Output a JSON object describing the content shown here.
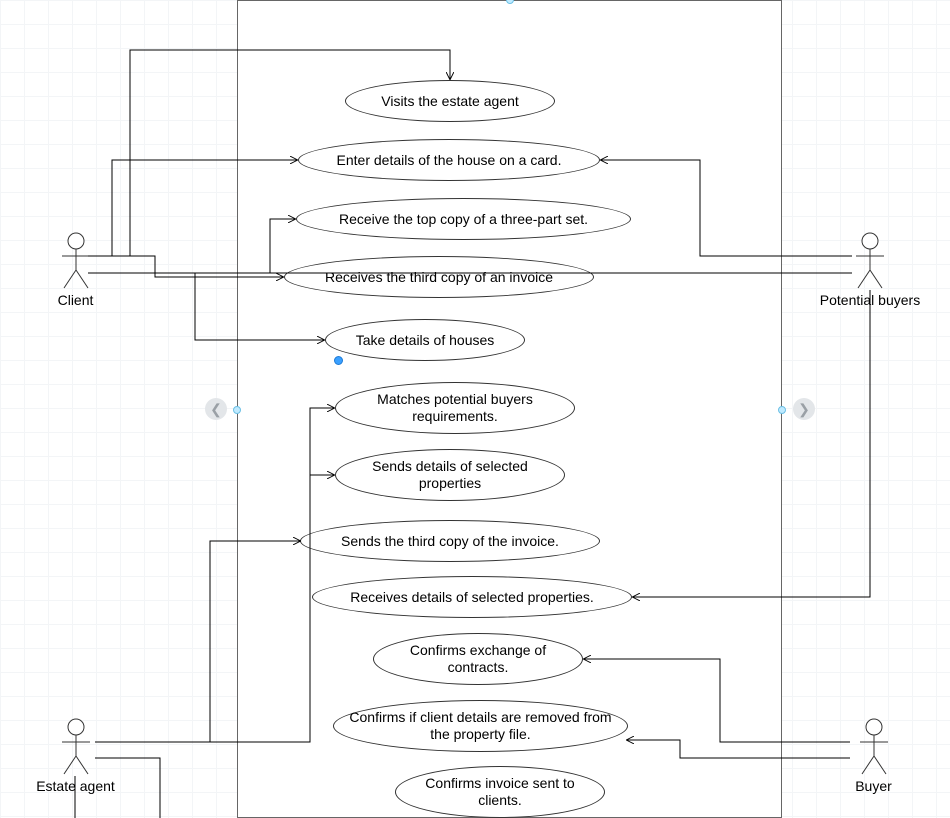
{
  "actors": {
    "client": {
      "label": "Client"
    },
    "potential_buyers": {
      "label": "Potential buyers"
    },
    "estate_agent": {
      "label": "Estate agent"
    },
    "buyer": {
      "label": "Buyer"
    }
  },
  "usecases": {
    "uc1": {
      "label": "Visits the estate agent"
    },
    "uc2": {
      "label": "Enter details of the house on a card."
    },
    "uc3": {
      "label": "Receive the top copy of a three-part set."
    },
    "uc4": {
      "label": "Receives the third copy of an invoice"
    },
    "uc5": {
      "label": "Take details of houses"
    },
    "uc6": {
      "label": "Matches potential buyers requirements."
    },
    "uc7": {
      "label": "Sends details of selected properties"
    },
    "uc8": {
      "label": "Sends the third copy of the invoice."
    },
    "uc9": {
      "label": "Receives details of selected properties."
    },
    "uc10": {
      "label": "Confirms exchange of contracts."
    },
    "uc11": {
      "label": "Confirms if client details are removed from the property file."
    },
    "uc12": {
      "label": "Confirms invoice sent to clients."
    }
  },
  "chart_data": {
    "type": "uml-use-case",
    "system_boundary": true,
    "actors": [
      "Client",
      "Potential buyers",
      "Estate agent",
      "Buyer"
    ],
    "usecases": [
      "Visits the estate agent",
      "Enter details of the house on a card.",
      "Receive the top copy of a three-part set.",
      "Receives the third copy of an invoice",
      "Take details of houses",
      "Matches potential buyers requirements.",
      "Sends details of selected properties",
      "Sends the third copy of the invoice.",
      "Receives details of selected properties.",
      "Confirms exchange of contracts.",
      "Confirms if client details are removed from the property file.",
      "Confirms invoice sent to clients."
    ],
    "associations": [
      {
        "actor": "Client",
        "usecase": "Visits the estate agent"
      },
      {
        "actor": "Client",
        "usecase": "Enter details of the house on a card."
      },
      {
        "actor": "Client",
        "usecase": "Receive the top copy of a three-part set."
      },
      {
        "actor": "Client",
        "usecase": "Receives the third copy of an invoice"
      },
      {
        "actor": "Potential buyers",
        "usecase": "Enter details of the house on a card."
      },
      {
        "actor": "Potential buyers",
        "usecase": "Take details of houses"
      },
      {
        "actor": "Potential buyers",
        "usecase": "Receives details of selected properties."
      },
      {
        "actor": "Estate agent",
        "usecase": "Matches potential buyers requirements."
      },
      {
        "actor": "Estate agent",
        "usecase": "Sends details of selected properties"
      },
      {
        "actor": "Estate agent",
        "usecase": "Sends the third copy of the invoice."
      },
      {
        "actor": "Estate agent",
        "usecase": "Confirms if client details are removed from the property file."
      },
      {
        "actor": "Estate agent",
        "usecase": "Confirms invoice sent to clients."
      },
      {
        "actor": "Buyer",
        "usecase": "Confirms exchange of contracts."
      },
      {
        "actor": "Buyer",
        "usecase": "Confirms if client details are removed from the property file."
      }
    ]
  }
}
